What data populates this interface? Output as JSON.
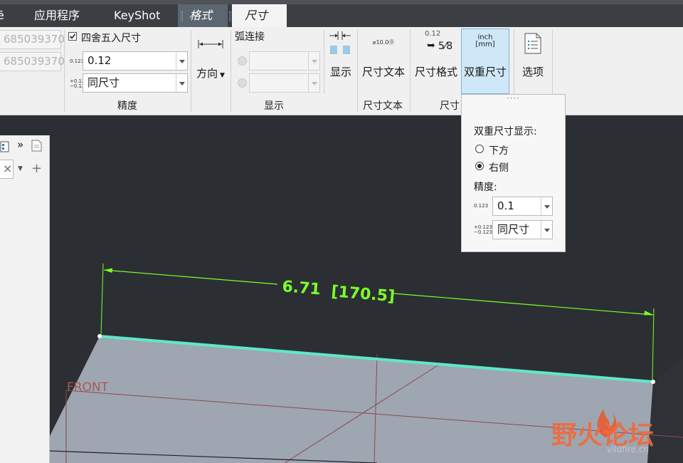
{
  "tabs": {
    "partial_first": "ē",
    "apps": "应用程序",
    "keyshot": "KeyShot",
    "format": "格式",
    "dimension": "尺寸"
  },
  "ribbon": {
    "left_values": [
      "685039370",
      "685039370"
    ],
    "round_checkbox_label": "四舍五入尺寸",
    "round_checked": true,
    "precision_value": "0.12",
    "tolerance_value": "同尺寸",
    "precision_group_label": "精度",
    "direction_label": "方向",
    "arc_connect_label": "弧连接",
    "display_button_label": "显示",
    "display_group_label": "显示",
    "dim_text_icon": "⌀10.0⓪",
    "dim_text_button_label": "尺寸文本",
    "dim_text_group_label": "尺寸文本",
    "dim_format_icon_top": "0.12",
    "dim_format_icon_bottom": "5⁄8",
    "dim_format_button_label": "尺寸格式",
    "dual_icon_top": "inch",
    "dual_icon_bottom": "[mm]",
    "dual_button_label": "双重尺寸",
    "dim_group_label_partial": "尺寸",
    "options_button_label": "选项"
  },
  "icons": {
    "checkbox": "checkbox-icon",
    "precision": "precision-icon",
    "tolerance": "tolerance-icon",
    "direction": "direction-arrows-icon",
    "display": "display-icon",
    "options": "document-list-icon",
    "dual": "dual-dimension-icon"
  },
  "popup": {
    "grip": "····",
    "title": "双重尺寸显示:",
    "options": [
      {
        "label": "下方",
        "selected": false
      },
      {
        "label": "右侧",
        "selected": true
      }
    ],
    "precision_label": "精度:",
    "precision_value": "0.1",
    "tolerance_value": "同尺寸"
  },
  "left_panel": {
    "more_glyph": "»",
    "close_glyph": "×",
    "add_glyph": "+"
  },
  "viewport": {
    "dimension_primary": "6.71",
    "dimension_secondary": "[170.5]",
    "plane_label": "FRONT",
    "dimension_color": "#7cff2a",
    "edge_color": "#5ee8c8"
  },
  "watermark": {
    "text": "野火论坛",
    "url_partial": "vildfire.cn"
  }
}
